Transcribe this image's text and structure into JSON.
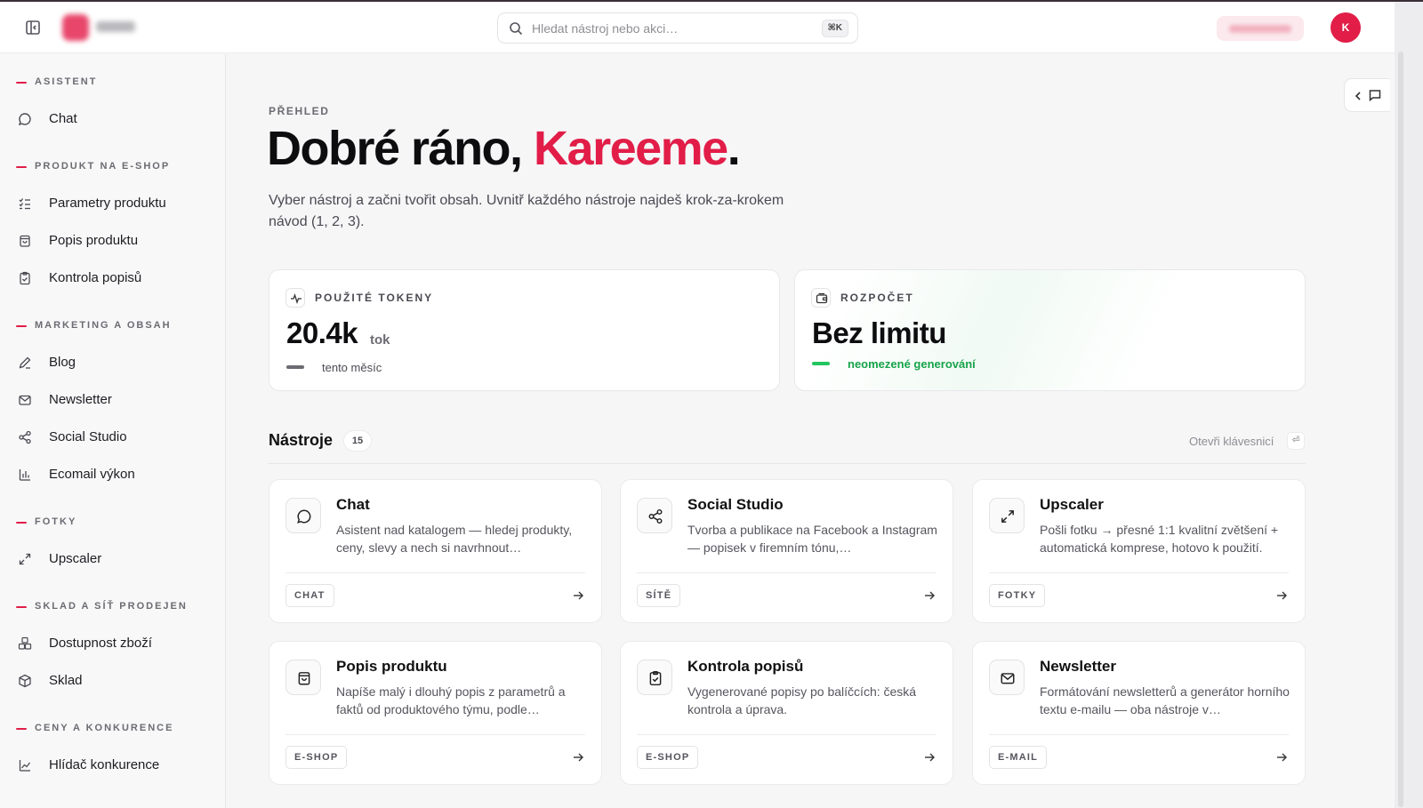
{
  "topbar": {
    "search_placeholder": "Hledat nástroj nebo akci…",
    "search_shortcut": "⌘K",
    "user_initial": "K"
  },
  "sidebar": {
    "sections": [
      {
        "label": "ASISTENT",
        "items": [
          {
            "label": "Chat",
            "icon": "chat-bubble-icon"
          }
        ]
      },
      {
        "label": "PRODUKT NA E-SHOP",
        "items": [
          {
            "label": "Parametry produktu",
            "icon": "checklist-icon"
          },
          {
            "label": "Popis produktu",
            "icon": "shopping-bag-icon"
          },
          {
            "label": "Kontrola popisů",
            "icon": "clipboard-check-icon"
          }
        ]
      },
      {
        "label": "MARKETING A OBSAH",
        "items": [
          {
            "label": "Blog",
            "icon": "pen-icon"
          },
          {
            "label": "Newsletter",
            "icon": "mail-icon"
          },
          {
            "label": "Social Studio",
            "icon": "share-icon"
          },
          {
            "label": "Ecomail výkon",
            "icon": "bar-chart-icon"
          }
        ]
      },
      {
        "label": "FOTKY",
        "items": [
          {
            "label": "Upscaler",
            "icon": "expand-icon"
          }
        ]
      },
      {
        "label": "SKLAD A SÍŤ PRODEJEN",
        "items": [
          {
            "label": "Dostupnost zboží",
            "icon": "boxes-icon"
          },
          {
            "label": "Sklad",
            "icon": "package-icon"
          }
        ]
      },
      {
        "label": "CENY A KONKURENCE",
        "items": [
          {
            "label": "Hlídač konkurence",
            "icon": "line-chart-icon"
          }
        ]
      }
    ]
  },
  "main": {
    "eyebrow": "PŘEHLED",
    "greeting": "Dobré ráno, ",
    "name": "Kareeme",
    "greeting_end": ".",
    "intro": "Vyber nástroj a začni tvořit obsah. Uvnitř každého nástroje najdeš krok-za-krokem návod (1, 2, 3).",
    "stats": [
      {
        "label": "POUŽITÉ TOKENY",
        "value": "20.4k",
        "unit": "tok",
        "sub": "tento měsíc",
        "icon": "activity-icon"
      },
      {
        "label": "ROZPOČET",
        "value": "Bez limitu",
        "sub": "neomezené generování",
        "icon": "wallet-icon"
      }
    ],
    "tools_title": "Nástroje",
    "tools_count": "15",
    "keyboard_hint": "Otevři klávesnicí",
    "keyboard_key": "⏎",
    "tools": [
      {
        "title": "Chat",
        "desc": "Asistent nad katalogem — hledej produkty, ceny, slevy a nech si navrhnout…",
        "tag": "CHAT",
        "icon": "chat-bubble-icon"
      },
      {
        "title": "Social Studio",
        "desc": "Tvorba a publikace na Facebook a Instagram — popisek v firemním tónu,…",
        "tag": "SÍTĚ",
        "icon": "share-icon"
      },
      {
        "title": "Upscaler",
        "desc": "Pošli fotku → přesné 1:1 kvalitní zvětšení + automatická komprese, hotovo k použití.",
        "tag": "FOTKY",
        "icon": "expand-icon"
      },
      {
        "title": "Popis produktu",
        "desc": "Napíše malý i dlouhý popis z parametrů a faktů od produktového týmu, podle…",
        "tag": "E-SHOP",
        "icon": "shopping-bag-icon"
      },
      {
        "title": "Kontrola popisů",
        "desc": "Vygenerované popisy po balíčcích: česká kontrola a úprava.",
        "tag": "E-SHOP",
        "icon": "clipboard-check-icon"
      },
      {
        "title": "Newsletter",
        "desc": "Formátování newsletterů a generátor horního textu e-mailu — oba nástroje v…",
        "tag": "E-MAIL",
        "icon": "mail-icon"
      }
    ]
  },
  "colors": {
    "accent": "#e11d48",
    "success": "#16a34a",
    "text": "#111111"
  }
}
